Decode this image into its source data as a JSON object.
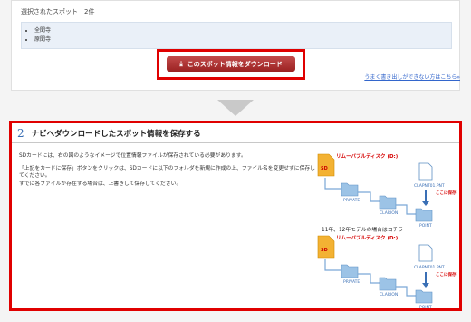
{
  "selection": {
    "title": "選択されたスポット　2件",
    "items": [
      "全聞寺",
      "原聞寺"
    ]
  },
  "download_button": {
    "label": "このスポット情報をダウンロード",
    "icon": "download-icon"
  },
  "help_link": "うまく書き出しができない方はこちら»",
  "section": {
    "number": "2",
    "title": "ナビへダウンロードしたスポット情報を保存する",
    "paragraph1": "SDカードには、右の図のようなイメージで位置情報ファイルが保存されている必要があります。",
    "paragraph2": "「上記をカードに保存」ボタンをクリックは、SDカードに以下のフォルダを新規に作成の上、ファイル名を変更せずに保存してください。",
    "paragraph3": "すでに各ファイルが存在する場合は、上書きして保存してください。",
    "diagram": {
      "drive_label": "リムーバブルディスク (D:)",
      "sd_label": "SD",
      "private": "PRIVATE",
      "clarion": "CLARION",
      "point": "POINT",
      "file": "CLAPNT01.PNT",
      "save_here": "ここに保存"
    },
    "caption": "11年、12年モデルの場合はコチラ"
  },
  "colors": {
    "accent": "#e00000",
    "button": "#a52a2a",
    "link": "#3366cc",
    "folder": "#9cc3e6",
    "sd": "#f3b233"
  }
}
